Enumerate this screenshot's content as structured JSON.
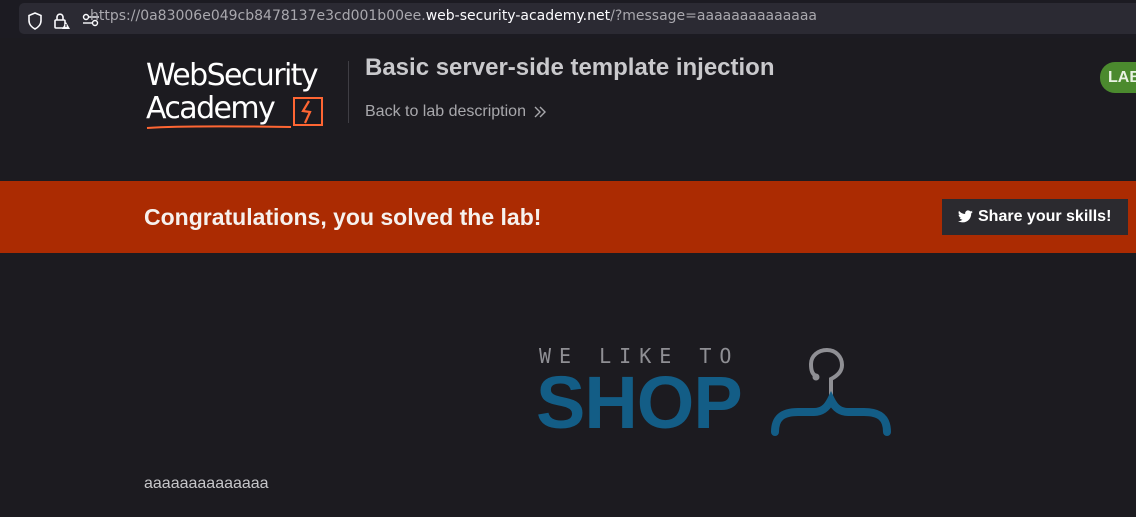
{
  "browser": {
    "url_scheme": "https://",
    "url_subdomain": "0a83006e049cb8478137e3cd001b00ee.",
    "url_host": "web-security-academy.net",
    "url_path": "/?message=aaaaaaaaaaaaaa",
    "icons": [
      "shield-icon",
      "lock-icon",
      "permissions-icon"
    ]
  },
  "header": {
    "logo_line1": "WebSecurity",
    "logo_line2": "Academy",
    "lab_title": "Basic server-side template injection",
    "back_link": "Back to lab description",
    "lab_status_badge": "LAB"
  },
  "banner": {
    "message": "Congratulations, you solved the lab!",
    "share_label": "Share your skills!"
  },
  "shop": {
    "tagline": "WE LIKE TO",
    "wordmark": "SHOP",
    "message_output": "aaaaaaaaaaaaaa"
  },
  "colors": {
    "page_bg": "#1c1b20",
    "banner_bg": "#ab2b02",
    "badge_green": "#4b8a2e",
    "shop_blue": "#135d86",
    "logo_accent": "#ff6633"
  }
}
